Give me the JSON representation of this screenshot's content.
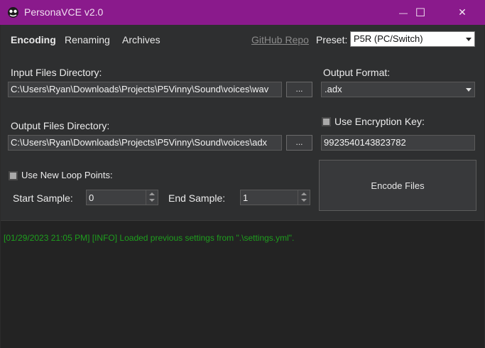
{
  "window": {
    "title": "PersonaVCE v2.0",
    "titlebar_color": "#8a1a8c",
    "icon": "app-logo-icon",
    "controls": {
      "minimize": "—",
      "maximize": "☐",
      "close": "✕"
    }
  },
  "nav": {
    "tabs": [
      {
        "label": "Encoding",
        "active": true
      },
      {
        "label": "Renaming",
        "active": false
      },
      {
        "label": "Archives",
        "active": false
      }
    ],
    "github_link": "GitHub Repo",
    "preset_label": "Preset:",
    "preset_value": "P5R (PC/Switch)"
  },
  "input": {
    "label": "Input Files Directory:",
    "value": "C:\\Users\\Ryan\\Downloads\\Projects\\P5Vinny\\Sound\\voices\\wav",
    "browse": "..."
  },
  "output": {
    "label": "Output Files Directory:",
    "value": "C:\\Users\\Ryan\\Downloads\\Projects\\P5Vinny\\Sound\\voices\\adx",
    "browse": "..."
  },
  "format": {
    "label": "Output Format:",
    "value": ".adx"
  },
  "encryption": {
    "label": "Use Encryption Key:",
    "checked": false,
    "value": "9923540143823782"
  },
  "loop": {
    "label": "Use New Loop Points:",
    "checked": false,
    "start_label": "Start Sample:",
    "start_value": "0",
    "end_label": "End Sample:",
    "end_value": "1"
  },
  "encode_button": "Encode Files",
  "log": {
    "lines": [
      "[01/29/2023 21:05 PM] [INFO] Loaded previous settings from \".\\settings.yml\"."
    ],
    "color": "#1e9e1e"
  }
}
